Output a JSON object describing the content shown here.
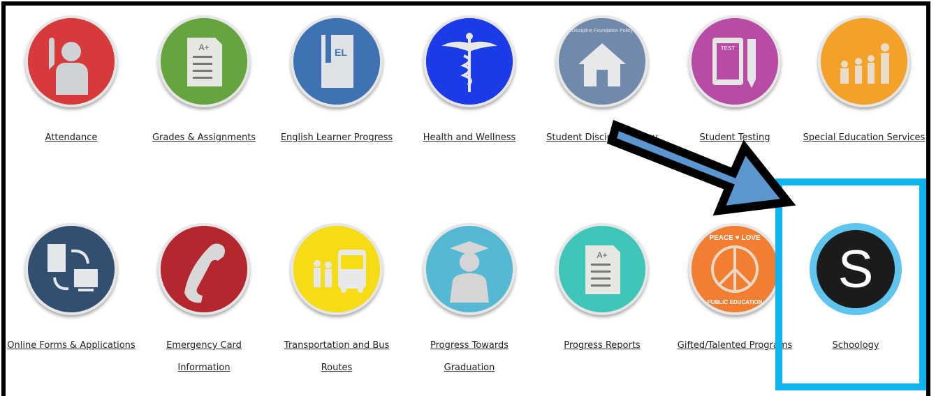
{
  "tiles_row1": [
    {
      "label": "Attendance",
      "icon": "raised-hand-person-icon",
      "color": "#d32f2f"
    },
    {
      "label": "Grades & Assignments",
      "icon": "grade-sheet-icon",
      "color": "#5f9b3a"
    },
    {
      "label": "English Learner Progress",
      "icon": "el-book-icon",
      "color": "#3d6fae"
    },
    {
      "label": "Health and Wellness",
      "icon": "caduceus-icon",
      "color": "#1432e6"
    },
    {
      "label": "Student Discipline Policy",
      "icon": "house-icon",
      "color": "#6d86a8",
      "badge_text": "Discipline Foundation Policy"
    },
    {
      "label": "Student Testing",
      "icon": "test-pencil-icon",
      "color": "#b3479e"
    },
    {
      "label": "Special Education Services",
      "icon": "family-icon",
      "color": "#f39a21"
    }
  ],
  "tiles_row2": [
    {
      "label": "Online Forms & Applications",
      "icon": "sync-computers-icon",
      "color": "#2f4b6b"
    },
    {
      "label": "Emergency Card Information",
      "icon": "phone-handset-icon",
      "color": "#b0242b"
    },
    {
      "label": "Transportation and Bus Routes",
      "icon": "bus-students-icon",
      "color": "#f5d90f"
    },
    {
      "label": "Progress Towards Graduation",
      "icon": "graduate-icon",
      "color": "#4fb4cf"
    },
    {
      "label": "Progress Reports",
      "icon": "report-sheet-icon",
      "color": "#3ac3b4"
    },
    {
      "label": "Gifted/Talented Programs",
      "icon": "peace-love-badge-icon",
      "color": "#f07a2d",
      "badge_top": "PEACE ♥ LOVE",
      "badge_bottom": "PUBLIC EDUCATION"
    },
    {
      "label": "Schoology",
      "icon": "schoology-s-icon",
      "color": "#1b1b1b",
      "letter": "S"
    }
  ],
  "icon_text": {
    "grade": "A+",
    "el": "EL",
    "test": "TEST",
    "report_grade": "A+"
  },
  "highlight_color": "#0fb3ef",
  "arrow_color": "#5b96cf"
}
